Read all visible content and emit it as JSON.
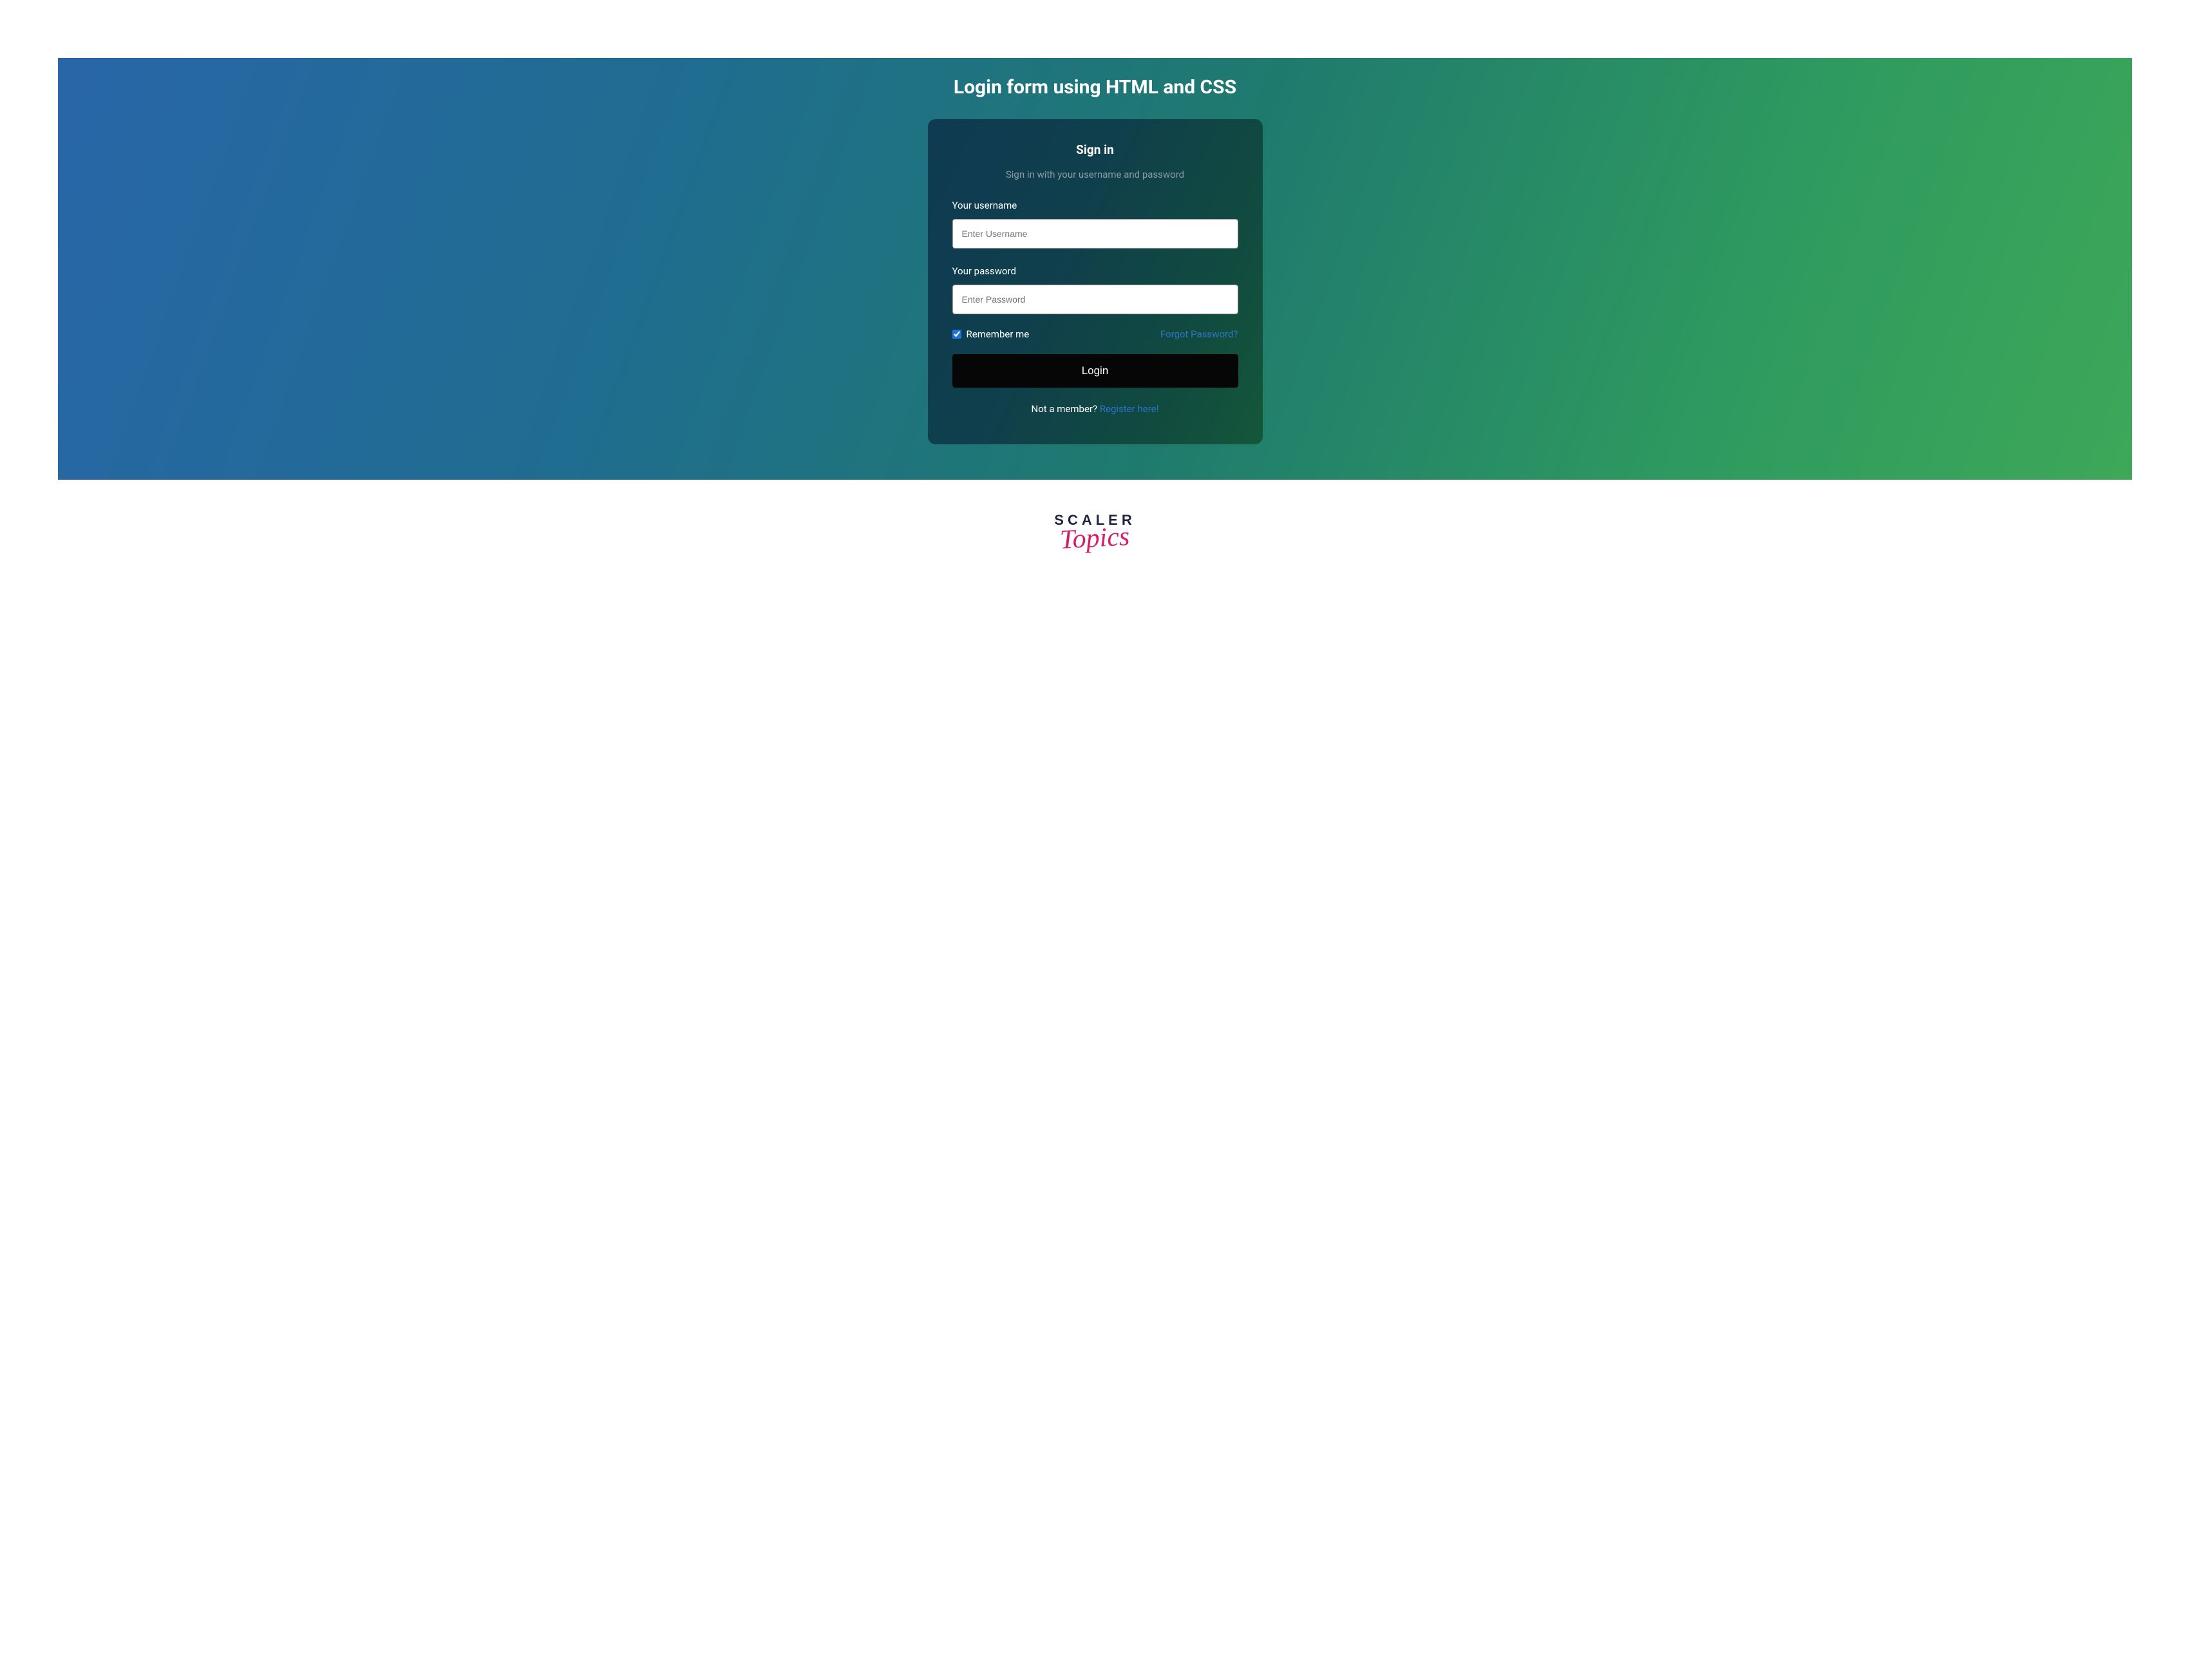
{
  "page": {
    "title": "Login form using HTML and CSS"
  },
  "card": {
    "heading": "Sign in",
    "subheading": "Sign in with your username and password"
  },
  "form": {
    "username_label": "Your username",
    "username_placeholder": "Enter Username",
    "username_value": "",
    "password_label": "Your password",
    "password_placeholder": "Enter Password",
    "password_value": "",
    "remember_label": "Remember me",
    "remember_checked": true,
    "forgot_label": "Forgot Password?",
    "login_button": "Login",
    "not_member_text": "Not a member? ",
    "register_link": "Register here!"
  },
  "brand": {
    "line1": "SCALER",
    "line2": "Topics"
  }
}
